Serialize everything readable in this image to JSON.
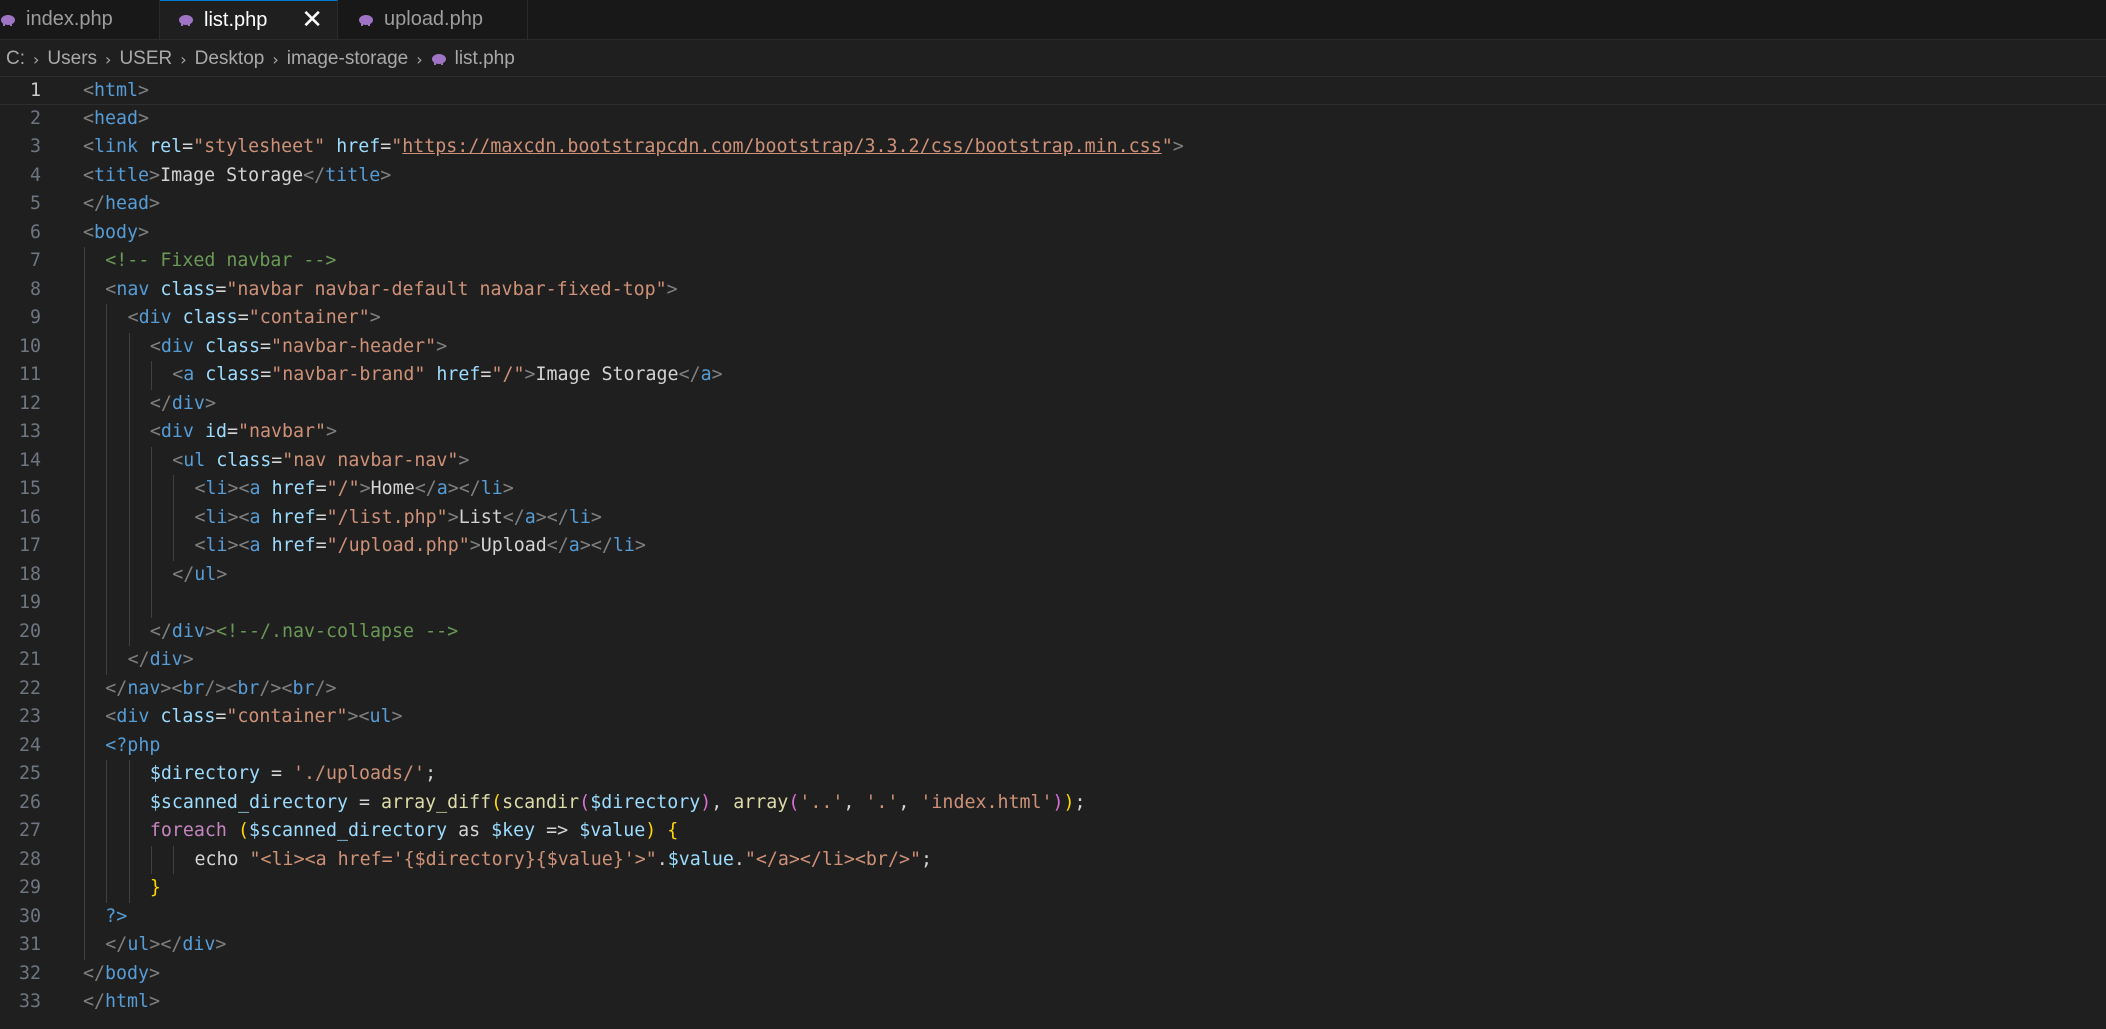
{
  "tabs": [
    {
      "label": "index.php",
      "active": false
    },
    {
      "label": "list.php",
      "active": true
    },
    {
      "label": "upload.php",
      "active": false
    }
  ],
  "tab_close_glyph": "✕",
  "breadcrumb": [
    "C:",
    "Users",
    "USER",
    "Desktop",
    "image-storage",
    "list.php"
  ],
  "icons": {
    "php_file": "php-elephant-icon",
    "chevron": "chevron-right-icon"
  },
  "colors": {
    "accent": "#0078d4",
    "editor_bg": "#1f1f1f",
    "php_icon": "#a074c4"
  },
  "current_line": 1,
  "lines": [
    {
      "n": 1,
      "indent": 0,
      "tokens": [
        [
          "br",
          "<"
        ],
        [
          "tag",
          "html"
        ],
        [
          "br",
          ">"
        ]
      ]
    },
    {
      "n": 2,
      "indent": 0,
      "tokens": [
        [
          "br",
          "<"
        ],
        [
          "tag",
          "head"
        ],
        [
          "br",
          ">"
        ]
      ]
    },
    {
      "n": 3,
      "indent": 0,
      "tokens": [
        [
          "br",
          "<"
        ],
        [
          "tag",
          "link"
        ],
        [
          "txt",
          " "
        ],
        [
          "attr",
          "rel"
        ],
        [
          "txt",
          "="
        ],
        [
          "str",
          "\"stylesheet\""
        ],
        [
          "txt",
          " "
        ],
        [
          "attr",
          "href"
        ],
        [
          "txt",
          "="
        ],
        [
          "str",
          "\""
        ],
        [
          "url",
          "https://maxcdn.bootstrapcdn.com/bootstrap/3.3.2/css/bootstrap.min.css"
        ],
        [
          "str",
          "\""
        ],
        [
          "br",
          ">"
        ]
      ]
    },
    {
      "n": 4,
      "indent": 0,
      "tokens": [
        [
          "br",
          "<"
        ],
        [
          "tag",
          "title"
        ],
        [
          "br",
          ">"
        ],
        [
          "txt",
          "Image Storage"
        ],
        [
          "br",
          "</"
        ],
        [
          "tag",
          "title"
        ],
        [
          "br",
          ">"
        ]
      ]
    },
    {
      "n": 5,
      "indent": 0,
      "tokens": [
        [
          "br",
          "</"
        ],
        [
          "tag",
          "head"
        ],
        [
          "br",
          ">"
        ]
      ]
    },
    {
      "n": 6,
      "indent": 0,
      "tokens": [
        [
          "br",
          "<"
        ],
        [
          "tag",
          "body"
        ],
        [
          "br",
          ">"
        ]
      ]
    },
    {
      "n": 7,
      "indent": 1,
      "tokens": [
        [
          "cmt",
          "<!-- Fixed navbar -->"
        ]
      ]
    },
    {
      "n": 8,
      "indent": 1,
      "tokens": [
        [
          "br",
          "<"
        ],
        [
          "tag",
          "nav"
        ],
        [
          "txt",
          " "
        ],
        [
          "attr",
          "class"
        ],
        [
          "txt",
          "="
        ],
        [
          "str",
          "\"navbar navbar-default navbar-fixed-top\""
        ],
        [
          "br",
          ">"
        ]
      ]
    },
    {
      "n": 9,
      "indent": 2,
      "tokens": [
        [
          "br",
          "<"
        ],
        [
          "tag",
          "div"
        ],
        [
          "txt",
          " "
        ],
        [
          "attr",
          "class"
        ],
        [
          "txt",
          "="
        ],
        [
          "str",
          "\"container\""
        ],
        [
          "br",
          ">"
        ]
      ]
    },
    {
      "n": 10,
      "indent": 3,
      "tokens": [
        [
          "br",
          "<"
        ],
        [
          "tag",
          "div"
        ],
        [
          "txt",
          " "
        ],
        [
          "attr",
          "class"
        ],
        [
          "txt",
          "="
        ],
        [
          "str",
          "\"navbar-header\""
        ],
        [
          "br",
          ">"
        ]
      ]
    },
    {
      "n": 11,
      "indent": 4,
      "tokens": [
        [
          "br",
          "<"
        ],
        [
          "tag",
          "a"
        ],
        [
          "txt",
          " "
        ],
        [
          "attr",
          "class"
        ],
        [
          "txt",
          "="
        ],
        [
          "str",
          "\"navbar-brand\""
        ],
        [
          "txt",
          " "
        ],
        [
          "attr",
          "href"
        ],
        [
          "txt",
          "="
        ],
        [
          "str",
          "\"/\""
        ],
        [
          "br",
          ">"
        ],
        [
          "txt",
          "Image Storage"
        ],
        [
          "br",
          "</"
        ],
        [
          "tag",
          "a"
        ],
        [
          "br",
          ">"
        ]
      ]
    },
    {
      "n": 12,
      "indent": 3,
      "tokens": [
        [
          "br",
          "</"
        ],
        [
          "tag",
          "div"
        ],
        [
          "br",
          ">"
        ]
      ]
    },
    {
      "n": 13,
      "indent": 3,
      "tokens": [
        [
          "br",
          "<"
        ],
        [
          "tag",
          "div"
        ],
        [
          "txt",
          " "
        ],
        [
          "attr",
          "id"
        ],
        [
          "txt",
          "="
        ],
        [
          "str",
          "\"navbar\""
        ],
        [
          "br",
          ">"
        ]
      ]
    },
    {
      "n": 14,
      "indent": 4,
      "tokens": [
        [
          "br",
          "<"
        ],
        [
          "tag",
          "ul"
        ],
        [
          "txt",
          " "
        ],
        [
          "attr",
          "class"
        ],
        [
          "txt",
          "="
        ],
        [
          "str",
          "\"nav navbar-nav\""
        ],
        [
          "br",
          ">"
        ]
      ]
    },
    {
      "n": 15,
      "indent": 5,
      "tokens": [
        [
          "br",
          "<"
        ],
        [
          "tag",
          "li"
        ],
        [
          "br",
          "><"
        ],
        [
          "tag",
          "a"
        ],
        [
          "txt",
          " "
        ],
        [
          "attr",
          "href"
        ],
        [
          "txt",
          "="
        ],
        [
          "str",
          "\"/\""
        ],
        [
          "br",
          ">"
        ],
        [
          "txt",
          "Home"
        ],
        [
          "br",
          "</"
        ],
        [
          "tag",
          "a"
        ],
        [
          "br",
          "></"
        ],
        [
          "tag",
          "li"
        ],
        [
          "br",
          ">"
        ]
      ]
    },
    {
      "n": 16,
      "indent": 5,
      "tokens": [
        [
          "br",
          "<"
        ],
        [
          "tag",
          "li"
        ],
        [
          "br",
          "><"
        ],
        [
          "tag",
          "a"
        ],
        [
          "txt",
          " "
        ],
        [
          "attr",
          "href"
        ],
        [
          "txt",
          "="
        ],
        [
          "str",
          "\"/list.php\""
        ],
        [
          "br",
          ">"
        ],
        [
          "txt",
          "List"
        ],
        [
          "br",
          "</"
        ],
        [
          "tag",
          "a"
        ],
        [
          "br",
          "></"
        ],
        [
          "tag",
          "li"
        ],
        [
          "br",
          ">"
        ]
      ]
    },
    {
      "n": 17,
      "indent": 5,
      "tokens": [
        [
          "br",
          "<"
        ],
        [
          "tag",
          "li"
        ],
        [
          "br",
          "><"
        ],
        [
          "tag",
          "a"
        ],
        [
          "txt",
          " "
        ],
        [
          "attr",
          "href"
        ],
        [
          "txt",
          "="
        ],
        [
          "str",
          "\"/upload.php\""
        ],
        [
          "br",
          ">"
        ],
        [
          "txt",
          "Upload"
        ],
        [
          "br",
          "</"
        ],
        [
          "tag",
          "a"
        ],
        [
          "br",
          "></"
        ],
        [
          "tag",
          "li"
        ],
        [
          "br",
          ">"
        ]
      ]
    },
    {
      "n": 18,
      "indent": 4,
      "tokens": [
        [
          "br",
          "</"
        ],
        [
          "tag",
          "ul"
        ],
        [
          "br",
          ">"
        ]
      ]
    },
    {
      "n": 19,
      "indent": 4,
      "tokens": []
    },
    {
      "n": 20,
      "indent": 3,
      "tokens": [
        [
          "br",
          "</"
        ],
        [
          "tag",
          "div"
        ],
        [
          "br",
          ">"
        ],
        [
          "cmt",
          "<!--/.nav-collapse -->"
        ]
      ]
    },
    {
      "n": 21,
      "indent": 2,
      "tokens": [
        [
          "br",
          "</"
        ],
        [
          "tag",
          "div"
        ],
        [
          "br",
          ">"
        ]
      ]
    },
    {
      "n": 22,
      "indent": 1,
      "tokens": [
        [
          "br",
          "</"
        ],
        [
          "tag",
          "nav"
        ],
        [
          "br",
          "><"
        ],
        [
          "tag",
          "br"
        ],
        [
          "br",
          "/><"
        ],
        [
          "tag",
          "br"
        ],
        [
          "br",
          "/><"
        ],
        [
          "tag",
          "br"
        ],
        [
          "br",
          "/>"
        ]
      ]
    },
    {
      "n": 23,
      "indent": 1,
      "tokens": [
        [
          "br",
          "<"
        ],
        [
          "tag",
          "div"
        ],
        [
          "txt",
          " "
        ],
        [
          "attr",
          "class"
        ],
        [
          "txt",
          "="
        ],
        [
          "str",
          "\"container\""
        ],
        [
          "br",
          "><"
        ],
        [
          "tag",
          "ul"
        ],
        [
          "br",
          ">"
        ]
      ]
    },
    {
      "n": 24,
      "indent": 1,
      "tokens": [
        [
          "php",
          "<?php"
        ]
      ]
    },
    {
      "n": 25,
      "indent": 3,
      "tokens": [
        [
          "var",
          "$directory"
        ],
        [
          "op",
          " = "
        ],
        [
          "str",
          "'./uploads/'"
        ],
        [
          "op",
          ";"
        ]
      ]
    },
    {
      "n": 26,
      "indent": 3,
      "tokens": [
        [
          "var",
          "$scanned_directory"
        ],
        [
          "op",
          " = "
        ],
        [
          "fn",
          "array_diff"
        ],
        [
          "p1",
          "("
        ],
        [
          "fn",
          "scandir"
        ],
        [
          "p2",
          "("
        ],
        [
          "var",
          "$directory"
        ],
        [
          "p2",
          ")"
        ],
        [
          "op",
          ", "
        ],
        [
          "fn",
          "array"
        ],
        [
          "p2",
          "("
        ],
        [
          "str",
          "'..'"
        ],
        [
          "op",
          ", "
        ],
        [
          "str",
          "'.'"
        ],
        [
          "op",
          ", "
        ],
        [
          "str",
          "'index.html'"
        ],
        [
          "p2",
          ")"
        ],
        [
          "p1",
          ")"
        ],
        [
          "op",
          ";"
        ]
      ]
    },
    {
      "n": 27,
      "indent": 3,
      "tokens": [
        [
          "kw",
          "foreach"
        ],
        [
          "op",
          " "
        ],
        [
          "p1",
          "("
        ],
        [
          "var",
          "$scanned_directory"
        ],
        [
          "op",
          " as "
        ],
        [
          "var",
          "$key"
        ],
        [
          "op",
          " => "
        ],
        [
          "var",
          "$value"
        ],
        [
          "p1",
          ")"
        ],
        [
          "op",
          " "
        ],
        [
          "p1",
          "{"
        ]
      ]
    },
    {
      "n": 28,
      "indent": 5,
      "tokens": [
        [
          "txt",
          "echo "
        ],
        [
          "str",
          "\""
        ],
        [
          "str",
          "<li><a href='{$directory}{$value}'>"
        ],
        [
          "str",
          "\""
        ],
        [
          "op",
          "."
        ],
        [
          "var",
          "$value"
        ],
        [
          "op",
          "."
        ],
        [
          "str",
          "\"</a></li><br/>\""
        ],
        [
          "op",
          ";"
        ]
      ]
    },
    {
      "n": 29,
      "indent": 3,
      "tokens": [
        [
          "p1",
          "}"
        ]
      ]
    },
    {
      "n": 30,
      "indent": 1,
      "tokens": [
        [
          "php",
          "?>"
        ]
      ]
    },
    {
      "n": 31,
      "indent": 1,
      "tokens": [
        [
          "br",
          "</"
        ],
        [
          "tag",
          "ul"
        ],
        [
          "br",
          "></"
        ],
        [
          "tag",
          "div"
        ],
        [
          "br",
          ">"
        ]
      ]
    },
    {
      "n": 32,
      "indent": 0,
      "tokens": [
        [
          "br",
          "</"
        ],
        [
          "tag",
          "body"
        ],
        [
          "br",
          ">"
        ]
      ]
    },
    {
      "n": 33,
      "indent": 0,
      "tokens": [
        [
          "br",
          "</"
        ],
        [
          "tag",
          "html"
        ],
        [
          "br",
          ">"
        ]
      ]
    }
  ]
}
